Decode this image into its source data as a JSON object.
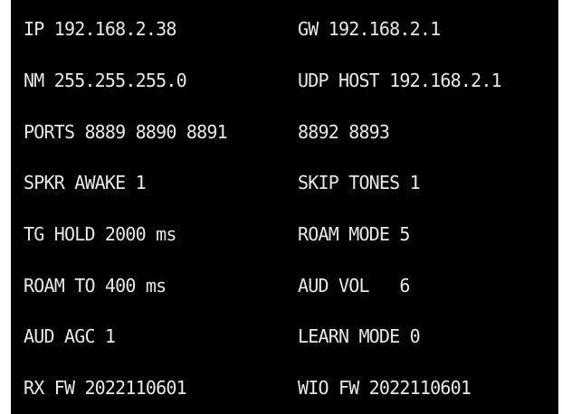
{
  "status": {
    "rows": [
      {
        "left": "IP 192.168.2.38",
        "right": "GW 192.168.2.1"
      },
      {
        "left": "NM 255.255.255.0",
        "right": "UDP HOST 192.168.2.1"
      },
      {
        "left": "PORTS 8889 8890 8891",
        "right": "8892 8893"
      },
      {
        "left": "SPKR AWAKE 1",
        "right": "SKIP TONES 1"
      },
      {
        "left": "TG HOLD 2000 ms",
        "right": "ROAM MODE 5"
      },
      {
        "left": "ROAM TO 400 ms",
        "right": "AUD VOL   6"
      },
      {
        "left": "AUD AGC 1",
        "right": "LEARN MODE 0"
      },
      {
        "left": "RX FW 2022110601",
        "right": "WIO FW 2022110601"
      }
    ]
  },
  "colors": {
    "background": "#000000",
    "text": "#e8e8e8"
  }
}
